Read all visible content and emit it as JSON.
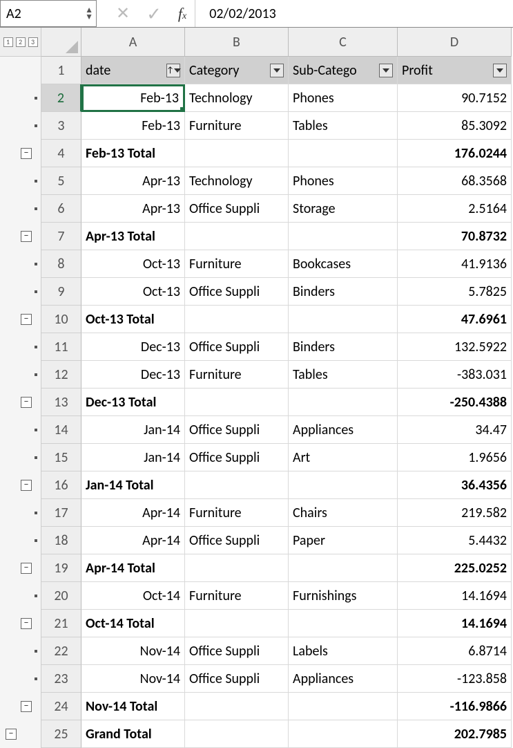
{
  "formula_bar": {
    "name_box": "A2",
    "formula_value": "02/02/2013"
  },
  "outline": {
    "levels": [
      "1",
      "2",
      "3"
    ]
  },
  "columns": {
    "a": "A",
    "b": "B",
    "c": "C",
    "d": "D"
  },
  "headers": {
    "a": "date",
    "b": "Category",
    "c": "Sub-Catego",
    "d": "Profit"
  },
  "row_nums": [
    "1",
    "2",
    "3",
    "4",
    "5",
    "6",
    "7",
    "8",
    "9",
    "10",
    "11",
    "12",
    "13",
    "14",
    "15",
    "16",
    "17",
    "18",
    "19",
    "20",
    "21",
    "22",
    "23",
    "24",
    "25"
  ],
  "rows": [
    {
      "a": "Feb-13",
      "b": "Technology",
      "c": "Phones",
      "d": "90.7152",
      "type": "data"
    },
    {
      "a": "Feb-13",
      "b": "Furniture",
      "c": "Tables",
      "d": "85.3092",
      "type": "data"
    },
    {
      "a": "Feb-13 Total",
      "b": "",
      "c": "",
      "d": "176.0244",
      "type": "total"
    },
    {
      "a": "Apr-13",
      "b": "Technology",
      "c": "Phones",
      "d": "68.3568",
      "type": "data"
    },
    {
      "a": "Apr-13",
      "b": "Office Suppli",
      "c": "Storage",
      "d": "2.5164",
      "type": "data"
    },
    {
      "a": "Apr-13 Total",
      "b": "",
      "c": "",
      "d": "70.8732",
      "type": "total"
    },
    {
      "a": "Oct-13",
      "b": "Furniture",
      "c": "Bookcases",
      "d": "41.9136",
      "type": "data"
    },
    {
      "a": "Oct-13",
      "b": "Office Suppli",
      "c": "Binders",
      "d": "5.7825",
      "type": "data"
    },
    {
      "a": "Oct-13 Total",
      "b": "",
      "c": "",
      "d": "47.6961",
      "type": "total"
    },
    {
      "a": "Dec-13",
      "b": "Office Suppli",
      "c": "Binders",
      "d": "132.5922",
      "type": "data"
    },
    {
      "a": "Dec-13",
      "b": "Furniture",
      "c": "Tables",
      "d": "-383.031",
      "type": "data"
    },
    {
      "a": "Dec-13 Total",
      "b": "",
      "c": "",
      "d": "-250.4388",
      "type": "total"
    },
    {
      "a": "Jan-14",
      "b": "Office Suppli",
      "c": "Appliances",
      "d": "34.47",
      "type": "data"
    },
    {
      "a": "Jan-14",
      "b": "Office Suppli",
      "c": "Art",
      "d": "1.9656",
      "type": "data"
    },
    {
      "a": "Jan-14 Total",
      "b": "",
      "c": "",
      "d": "36.4356",
      "type": "total"
    },
    {
      "a": "Apr-14",
      "b": "Furniture",
      "c": "Chairs",
      "d": "219.582",
      "type": "data"
    },
    {
      "a": "Apr-14",
      "b": "Office Suppli",
      "c": "Paper",
      "d": "5.4432",
      "type": "data"
    },
    {
      "a": "Apr-14 Total",
      "b": "",
      "c": "",
      "d": "225.0252",
      "type": "total"
    },
    {
      "a": "Oct-14",
      "b": "Furniture",
      "c": "Furnishings",
      "d": "14.1694",
      "type": "data"
    },
    {
      "a": "Oct-14 Total",
      "b": "",
      "c": "",
      "d": "14.1694",
      "type": "total"
    },
    {
      "a": "Nov-14",
      "b": "Office Suppli",
      "c": "Labels",
      "d": "6.8714",
      "type": "data"
    },
    {
      "a": "Nov-14",
      "b": "Office Suppli",
      "c": "Appliances",
      "d": "-123.858",
      "type": "data"
    },
    {
      "a": "Nov-14 Total",
      "b": "",
      "c": "",
      "d": "-116.9866",
      "type": "total"
    },
    {
      "a": "Grand Total",
      "b": "",
      "c": "",
      "d": "202.7985",
      "type": "grand"
    }
  ]
}
